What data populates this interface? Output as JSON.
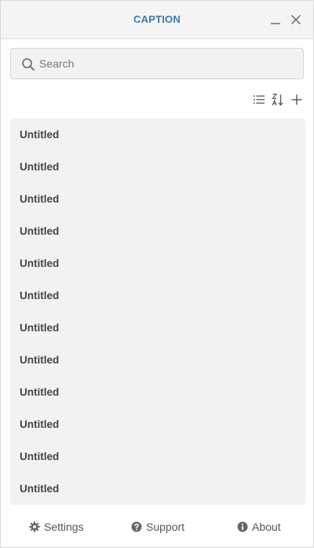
{
  "window": {
    "title": "CAPTION",
    "minimize_icon": "minimize-icon",
    "close_icon": "close-icon"
  },
  "search": {
    "placeholder": "Search",
    "value": "",
    "icon": "search-icon"
  },
  "toolbar": {
    "list_view_icon": "list-view-icon",
    "sort_icon": "sort-az-icon",
    "add_icon": "plus-icon"
  },
  "items": [
    {
      "label": "Untitled"
    },
    {
      "label": "Untitled"
    },
    {
      "label": "Untitled"
    },
    {
      "label": "Untitled"
    },
    {
      "label": "Untitled"
    },
    {
      "label": "Untitled"
    },
    {
      "label": "Untitled"
    },
    {
      "label": "Untitled"
    },
    {
      "label": "Untitled"
    },
    {
      "label": "Untitled"
    },
    {
      "label": "Untitled"
    },
    {
      "label": "Untitled"
    }
  ],
  "footer": {
    "settings_label": "Settings",
    "support_label": "Support",
    "about_label": "About"
  },
  "colors": {
    "accent": "#2f7dbd",
    "panel": "#f2f2f2",
    "text": "#444444"
  }
}
